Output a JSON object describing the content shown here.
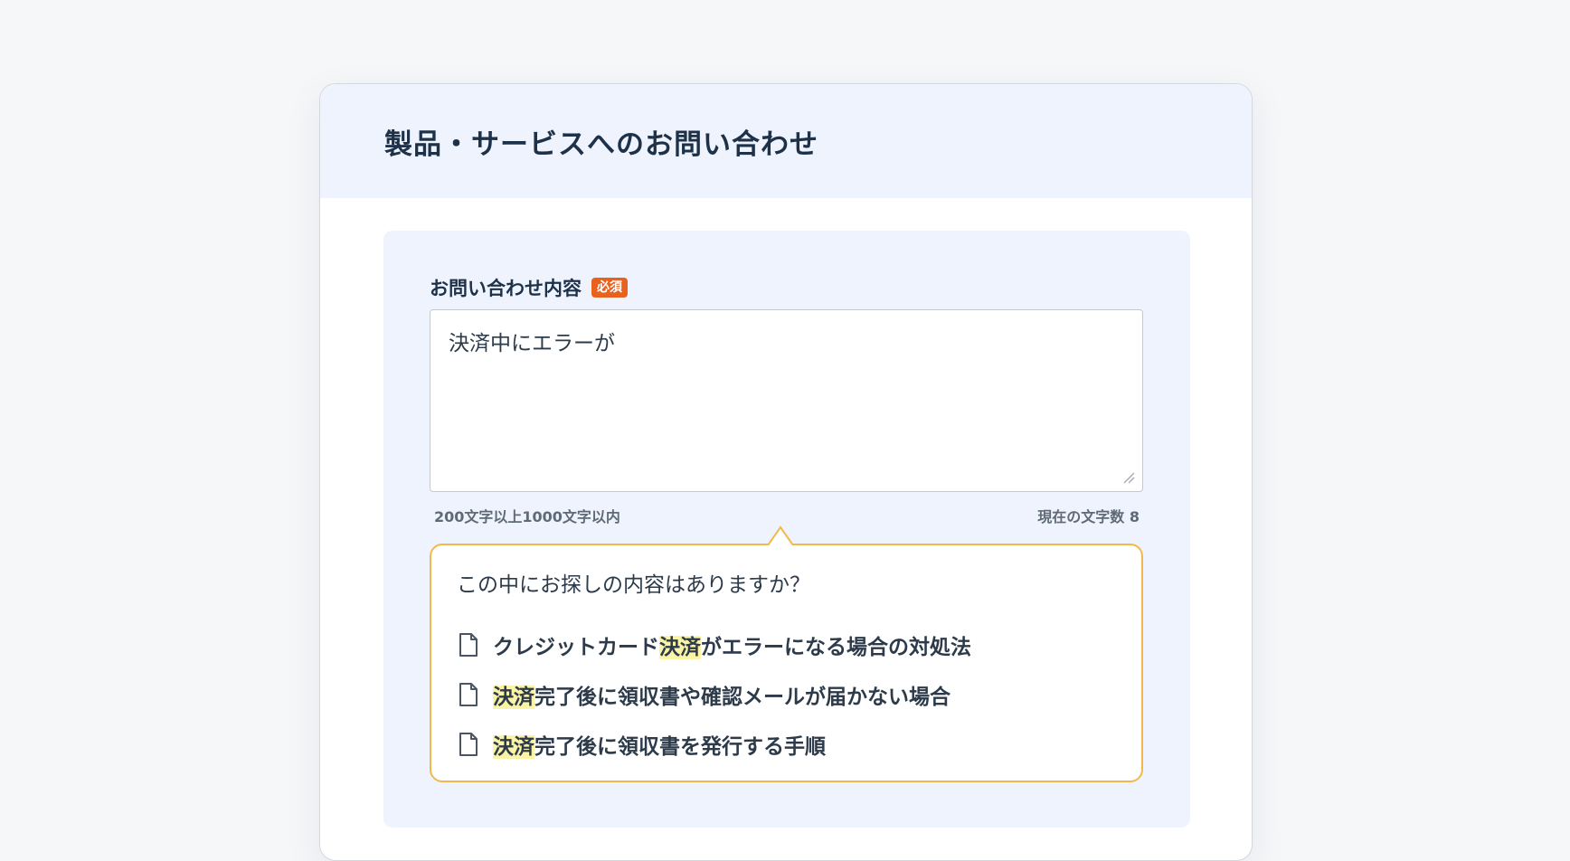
{
  "header": {
    "title": "製品・サービスへのお問い合わせ"
  },
  "field": {
    "label": "お問い合わせ内容",
    "required_badge": "必須",
    "value": "決済中にエラーが",
    "hint_length": "200文字以上1000文字以内",
    "char_count_label": "現在の文字数 8"
  },
  "suggestions": {
    "question": "この中にお探しの内容はありますか？",
    "icon": "document-icon",
    "items": [
      {
        "before": "クレジットカード",
        "match": "決済",
        "after": "がエラーになる場合の対処法"
      },
      {
        "before": "",
        "match": "決済",
        "after": "完了後に領収書や確認メールが届かない場合"
      },
      {
        "before": "",
        "match": "決済",
        "after": "完了後に領収書を発行する手順"
      }
    ]
  },
  "colors": {
    "badge": "#e8621d",
    "suggest_border": "#f2b94a",
    "highlight": "#fbf4a6",
    "header_bg": "#eff3fd"
  }
}
